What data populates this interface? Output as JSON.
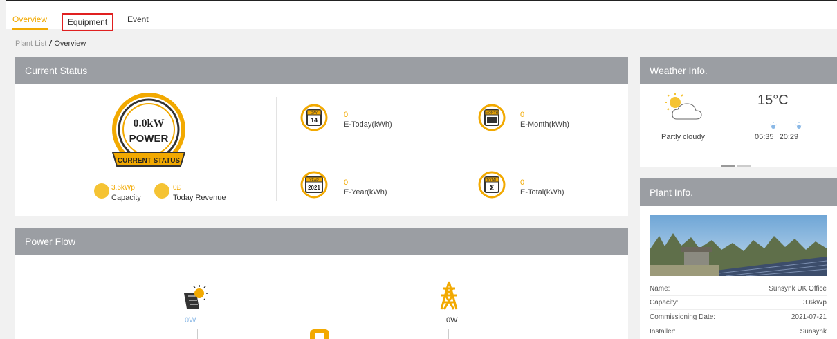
{
  "tabs": [
    {
      "label": "Overview",
      "active": true
    },
    {
      "label": "Equipment",
      "active": false
    },
    {
      "label": "Event",
      "active": false
    }
  ],
  "breadcrumb": {
    "root": "Plant List",
    "separator": "/",
    "current": "Overview"
  },
  "current_status": {
    "title": "Current Status",
    "gauge": {
      "value": "0.0kW",
      "label": "POWER",
      "ribbon": "CURRENT STATUS"
    },
    "capacity": {
      "value": "3.6kWp",
      "label": "Capacity"
    },
    "revenue": {
      "value": "0£",
      "label": "Today Revenue"
    },
    "energy": [
      {
        "icon_text": "14",
        "icon_badge": "DAY",
        "value": "0",
        "label": "E-Today(kWh)"
      },
      {
        "icon_text": "",
        "icon_badge": "MONTH",
        "value": "0",
        "label": "E-Month(kWh)"
      },
      {
        "icon_text": "2021",
        "icon_badge": "YEAR",
        "value": "0",
        "label": "E-Year(kWh)"
      },
      {
        "icon_text": "Σ",
        "icon_badge": "TOTAL",
        "value": "0",
        "label": "E-Total(kWh)"
      }
    ]
  },
  "weather": {
    "title": "Weather Info.",
    "temperature": "15°C",
    "description": "Partly cloudy",
    "sunrise": "05:35",
    "sunset": "20:29"
  },
  "power_flow": {
    "title": "Power Flow",
    "solar_value": "0W",
    "grid_value": "0W"
  },
  "plant_info": {
    "title": "Plant Info.",
    "rows": [
      {
        "key": "Name:",
        "value": "Sunsynk UK Office"
      },
      {
        "key": "Capacity:",
        "value": "3.6kWp"
      },
      {
        "key": "Commissioning Date:",
        "value": "2021-07-21"
      },
      {
        "key": "Installer:",
        "value": "Sunsynk"
      }
    ]
  },
  "colors": {
    "accent": "#f2a900",
    "header": "#9b9ea3",
    "highlight": "#e02020",
    "solar_blue": "#8ab8e6"
  }
}
